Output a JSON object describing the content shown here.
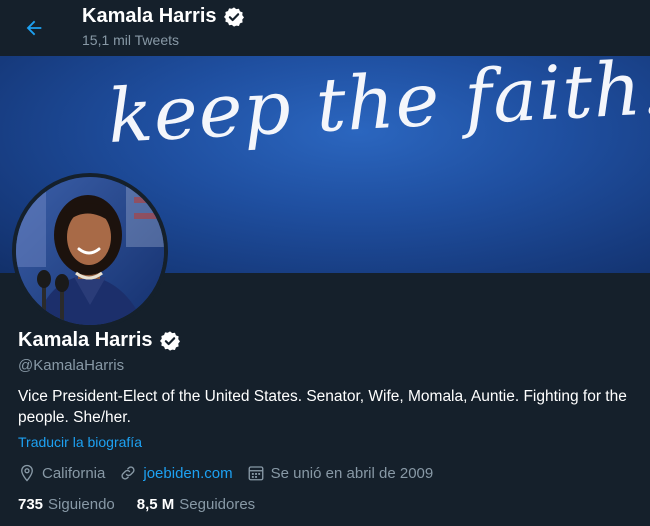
{
  "header": {
    "name": "Kamala Harris",
    "tweet_count": "15,1 mil Tweets"
  },
  "banner": {
    "text": "keep the faith!"
  },
  "profile": {
    "name": "Kamala Harris",
    "handle": "@KamalaHarris",
    "bio": "Vice President-Elect of the United States. Senator, Wife, Momala, Auntie. Fighting for the people. She/her.",
    "translate_label": "Traducir la biografía",
    "location": "California",
    "website": "joebiden.com",
    "joined": "Se unió en abril de 2009",
    "following_count": "735",
    "following_label": "Siguiendo",
    "followers_count": "8,5 M",
    "followers_label": "Seguidores"
  },
  "colors": {
    "background": "#15202b",
    "accent": "#1da1f2",
    "secondary_text": "#8899a6"
  },
  "icons": {
    "back": "arrow-left-icon",
    "verified": "verified-badge-icon",
    "location": "location-pin-icon",
    "link": "link-icon",
    "calendar": "calendar-icon"
  }
}
